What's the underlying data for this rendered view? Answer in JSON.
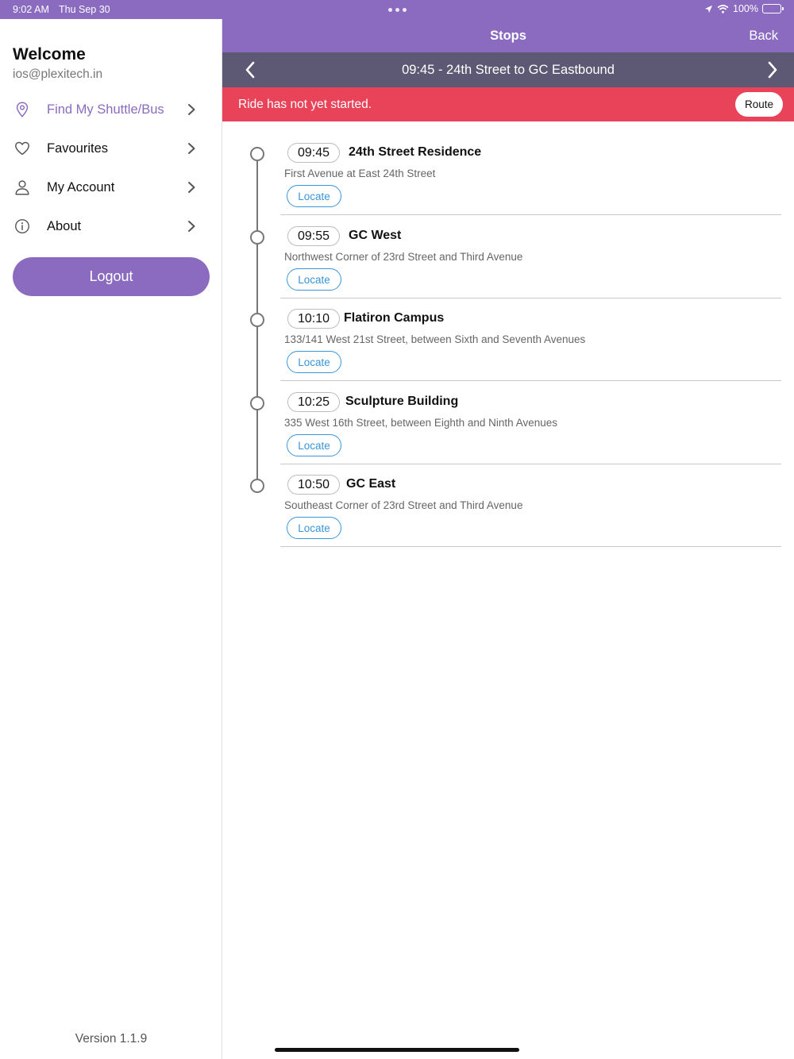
{
  "status_bar": {
    "time": "9:02 AM",
    "date": "Thu Sep 30",
    "battery": "100%"
  },
  "sidebar": {
    "welcome": "Welcome",
    "email": "ios@plexitech.in",
    "items": [
      {
        "label": "Find My Shuttle/Bus",
        "icon": "location-pin-icon",
        "active": true
      },
      {
        "label": "Favourites",
        "icon": "heart-icon",
        "active": false
      },
      {
        "label": "My Account",
        "icon": "person-icon",
        "active": false
      },
      {
        "label": "About",
        "icon": "info-icon",
        "active": false
      }
    ],
    "logout_label": "Logout",
    "version": "Version 1.1.9"
  },
  "nav": {
    "title": "Stops",
    "back_label": "Back"
  },
  "ride": {
    "title": "09:45 - 24th Street to GC Eastbound"
  },
  "alert": {
    "text": "Ride has not yet started.",
    "route_label": "Route"
  },
  "stops": [
    {
      "time": "09:45",
      "name": "24th Street Residence",
      "address": "First Avenue at East 24th Street",
      "locate_label": "Locate"
    },
    {
      "time": "09:55",
      "name": "GC West",
      "address": "Northwest Corner of 23rd Street and Third Avenue",
      "locate_label": "Locate"
    },
    {
      "time": "10:10",
      "name": "Flatiron Campus",
      "address": "133/141 West 21st Street, between Sixth and Seventh Avenues",
      "locate_label": "Locate"
    },
    {
      "time": "10:25",
      "name": "Sculpture Building",
      "address": "335 West 16th Street, between Eighth and Ninth Avenues",
      "locate_label": "Locate"
    },
    {
      "time": "10:50",
      "name": "GC East",
      "address": "Southeast Corner of 23rd Street and Third Avenue",
      "locate_label": "Locate"
    }
  ],
  "colors": {
    "brand_purple": "#8b6bc0",
    "ride_bar": "#5d5873",
    "alert_red": "#e9435a",
    "locate_blue": "#3b95d8"
  }
}
